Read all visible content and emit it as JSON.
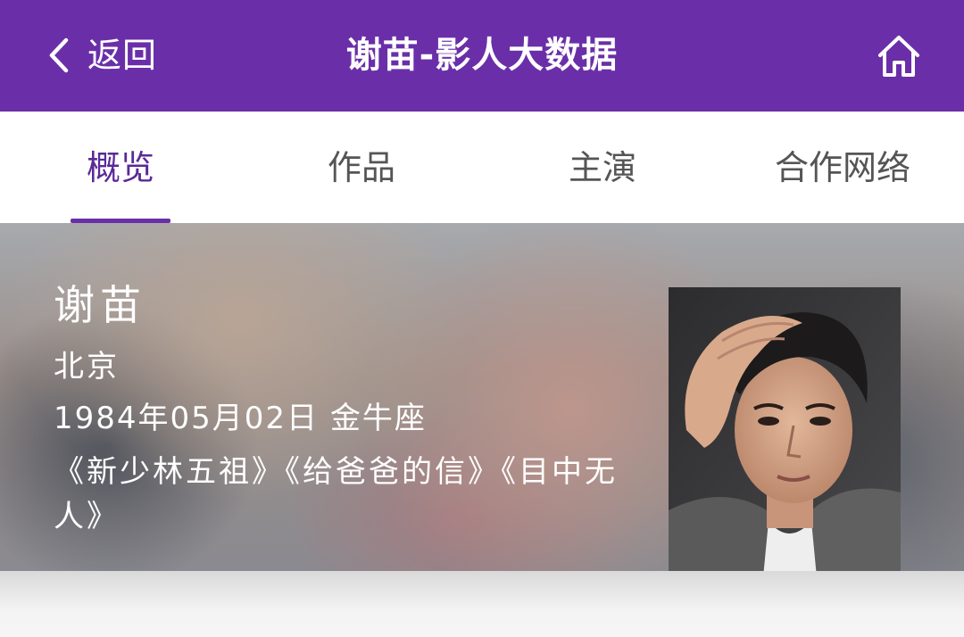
{
  "header": {
    "back_label": "返回",
    "title": "谢苗-影人大数据",
    "back_icon": "chevron-left-icon",
    "home_icon": "home-icon",
    "background_color": "#6a2fa8"
  },
  "tabs": [
    {
      "label": "概览",
      "active": true
    },
    {
      "label": "作品",
      "active": false
    },
    {
      "label": "主演",
      "active": false
    },
    {
      "label": "合作网络",
      "active": false
    }
  ],
  "profile": {
    "name": "谢苗",
    "birthplace": "北京",
    "birthdate": "1984年05月02日 金牛座",
    "works": "《新少林五祖》《给爸爸的信》《目中无人》",
    "portrait_alt": "actor-portrait-photo"
  },
  "colors": {
    "accent": "#6a2fa8",
    "active_tab_text": "#5a2a96",
    "inactive_tab_text": "#555555"
  }
}
